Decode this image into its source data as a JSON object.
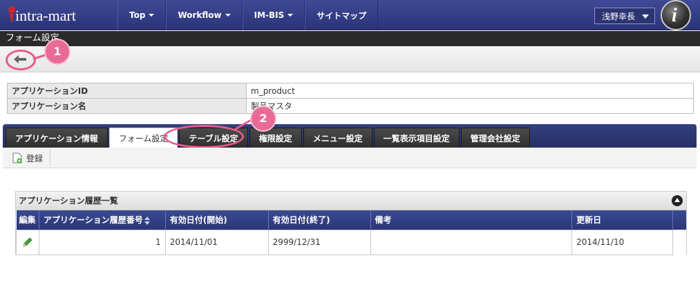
{
  "navbar": {
    "logo_text": "intra-mart",
    "items": [
      {
        "label": "Top",
        "dropdown": true
      },
      {
        "label": "Workflow",
        "dropdown": true
      },
      {
        "label": "IM-BIS",
        "dropdown": true
      },
      {
        "label": "サイトマップ",
        "dropdown": false
      }
    ],
    "user_name": "浅野幸長"
  },
  "page_title": "フォーム設定",
  "back_button_icon": "arrow-left-icon",
  "annotations": [
    {
      "number": "1"
    },
    {
      "number": "2"
    }
  ],
  "info_table": [
    {
      "label": "アプリケーションID",
      "value": "m_product"
    },
    {
      "label": "アプリケーション名",
      "value": "製品マスタ"
    }
  ],
  "tabs": [
    {
      "label": "アプリケーション情報",
      "active": false
    },
    {
      "label": "フォーム設定",
      "active": true
    },
    {
      "label": "テーブル設定",
      "active": false
    },
    {
      "label": "権限設定",
      "active": false
    },
    {
      "label": "メニュー設定",
      "active": false
    },
    {
      "label": "一覧表示項目設定",
      "active": false
    },
    {
      "label": "管理会社設定",
      "active": false
    }
  ],
  "toolbar": {
    "register_label": "登録"
  },
  "history": {
    "title": "アプリケーション履歴一覧",
    "columns": [
      "編集",
      "アプリケーション履歴番号",
      "有効日付(開始)",
      "有効日付(終了)",
      "備考",
      "更新日"
    ],
    "rows": [
      {
        "history_no": "1",
        "start": "2014/11/01",
        "end": "2999/12/31",
        "note": "",
        "updated": "2014/11/10"
      }
    ]
  },
  "colors": {
    "navbar": "#2b3478",
    "annotation": "#e85a8b",
    "grid_header": "#2a3677"
  }
}
